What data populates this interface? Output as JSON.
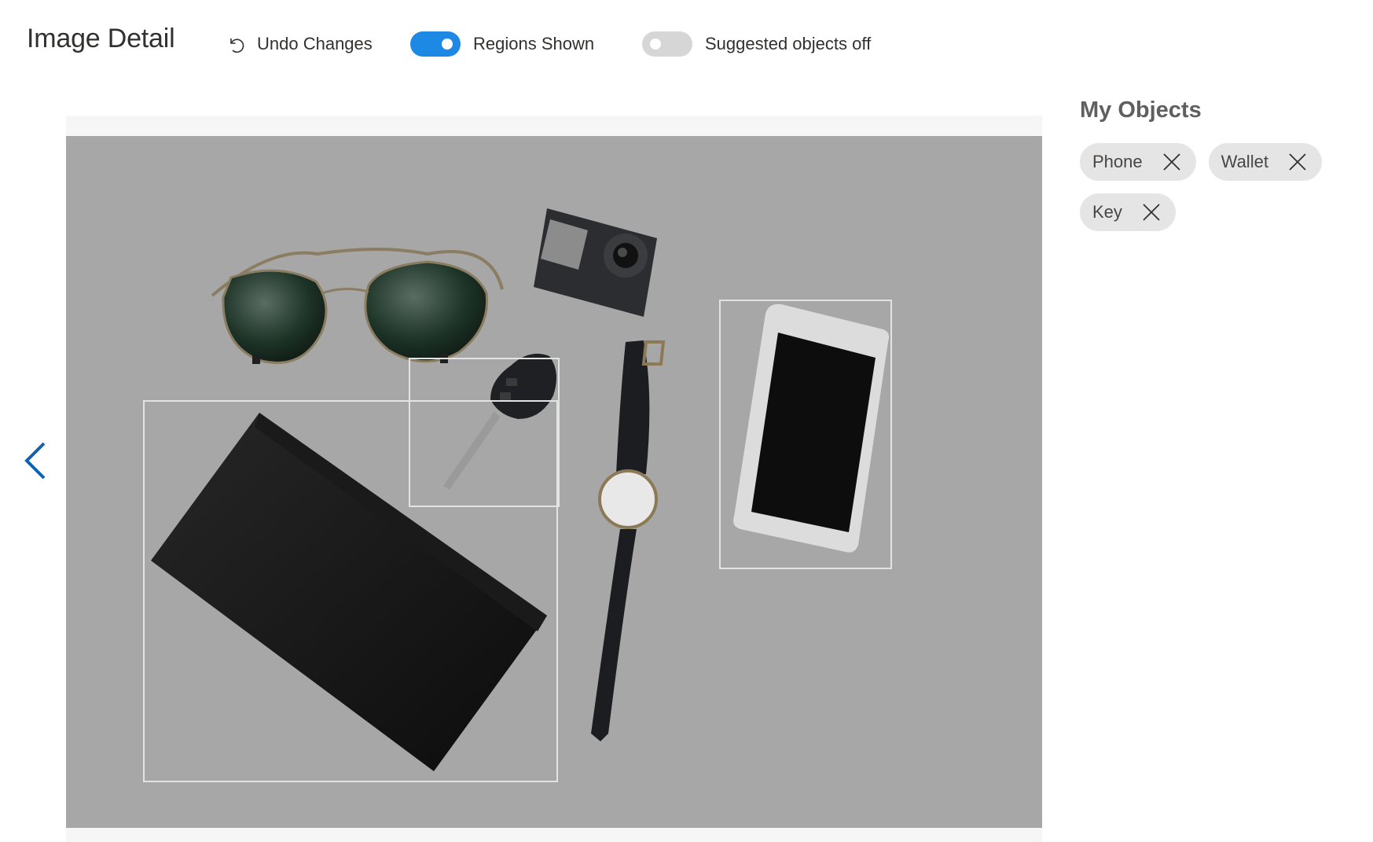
{
  "header": {
    "title": "Image Detail",
    "undo_label": "Undo Changes",
    "regions_toggle": {
      "label": "Regions Shown",
      "state": "on"
    },
    "suggested_toggle": {
      "label": "Suggested objects off",
      "state": "off"
    }
  },
  "navigation": {
    "prev_icon": "chevron-left-icon"
  },
  "image": {
    "scene_objects": [
      "sunglasses",
      "action-camera",
      "car-key",
      "wallet",
      "wristwatch",
      "smartphone"
    ],
    "regions": [
      "Wallet",
      "Key",
      "Phone"
    ]
  },
  "sidebar": {
    "title": "My Objects",
    "tags": [
      {
        "label": "Phone"
      },
      {
        "label": "Wallet"
      },
      {
        "label": "Key"
      }
    ]
  },
  "colors": {
    "accent": "#1e88e5",
    "image_overlay": "#a6a6a6",
    "tag_background": "#e5e5e5",
    "region_border": "#e3e3e3",
    "nav_arrow": "#0f62b0"
  }
}
